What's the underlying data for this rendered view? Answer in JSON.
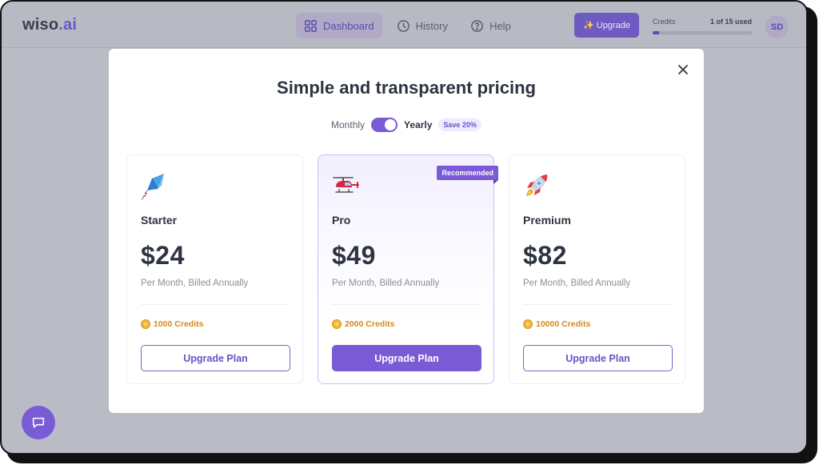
{
  "app": {
    "logo_main": "wiso",
    "logo_suffix": ".ai"
  },
  "nav": {
    "items": [
      {
        "label": "Dashboard",
        "icon": "grid-icon",
        "active": true
      },
      {
        "label": "History",
        "icon": "clock-icon",
        "active": false
      },
      {
        "label": "Help",
        "icon": "question-icon",
        "active": false
      }
    ]
  },
  "header": {
    "upgrade_label": "Upgrade",
    "upgrade_icon": "sparkle-icon",
    "credits_label": "Credits",
    "credits_used": "1 of 15 used",
    "credits_progress": 0.067,
    "avatar_initials": "SD"
  },
  "modal": {
    "title": "Simple and transparent pricing",
    "close_icon": "close-icon",
    "billing_monthly": "Monthly",
    "billing_yearly": "Yearly",
    "billing_selected": "Yearly",
    "save_badge": "Save 20%",
    "plans": [
      {
        "name": "Starter",
        "icon": "kite-icon",
        "price": "$24",
        "period": "Per Month, Billed Annually",
        "credits": "1000 Credits",
        "button": "Upgrade Plan",
        "recommended": false
      },
      {
        "name": "Pro",
        "icon": "helicopter-icon",
        "price": "$49",
        "period": "Per Month, Billed Annually",
        "credits": "2000 Credits",
        "button": "Upgrade Plan",
        "recommended": true,
        "badge": "Recommended"
      },
      {
        "name": "Premium",
        "icon": "rocket-icon",
        "price": "$82",
        "period": "Per Month, Billed Annually",
        "credits": "10000 Credits",
        "button": "Upgrade Plan",
        "recommended": false
      }
    ]
  },
  "chat": {
    "icon": "chat-icon"
  },
  "colors": {
    "accent": "#7b5ad6",
    "credit": "#d48a1c",
    "overlay": "#b9bcc4"
  }
}
